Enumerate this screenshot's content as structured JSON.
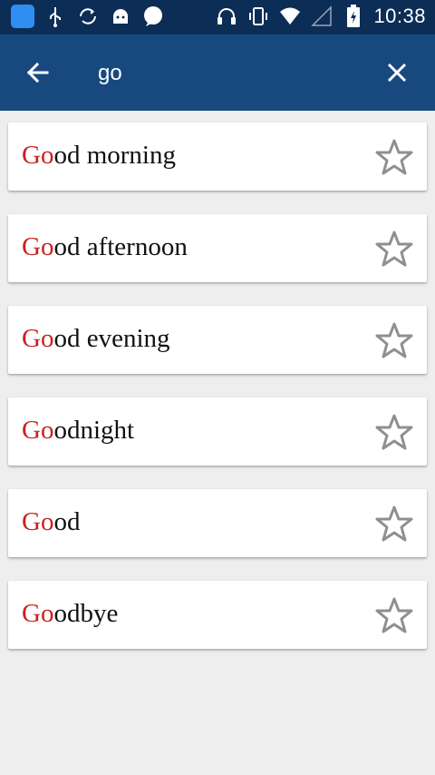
{
  "status_bar": {
    "time": "10:38",
    "left_icons": [
      "app-badge-icon",
      "usb-icon",
      "sync-icon",
      "android-icon",
      "chat-icon"
    ],
    "right_icons": [
      "headset-icon",
      "vibrate-icon",
      "wifi-icon",
      "signal-icon",
      "battery-icon"
    ]
  },
  "toolbar": {
    "search_value": "go",
    "back_icon": "arrow-left-icon",
    "clear_icon": "close-icon"
  },
  "results": [
    {
      "highlight": "Go",
      "rest": "od morning"
    },
    {
      "highlight": "Go",
      "rest": "od afternoon"
    },
    {
      "highlight": "Go",
      "rest": "od evening"
    },
    {
      "highlight": "Go",
      "rest": "odnight"
    },
    {
      "highlight": "Go",
      "rest": "od"
    },
    {
      "highlight": "Go",
      "rest": "odbye"
    }
  ],
  "colors": {
    "status_bar": "#0c2d55",
    "toolbar": "#17497f",
    "highlight": "#cc1f1f",
    "background": "#eeeeee"
  }
}
